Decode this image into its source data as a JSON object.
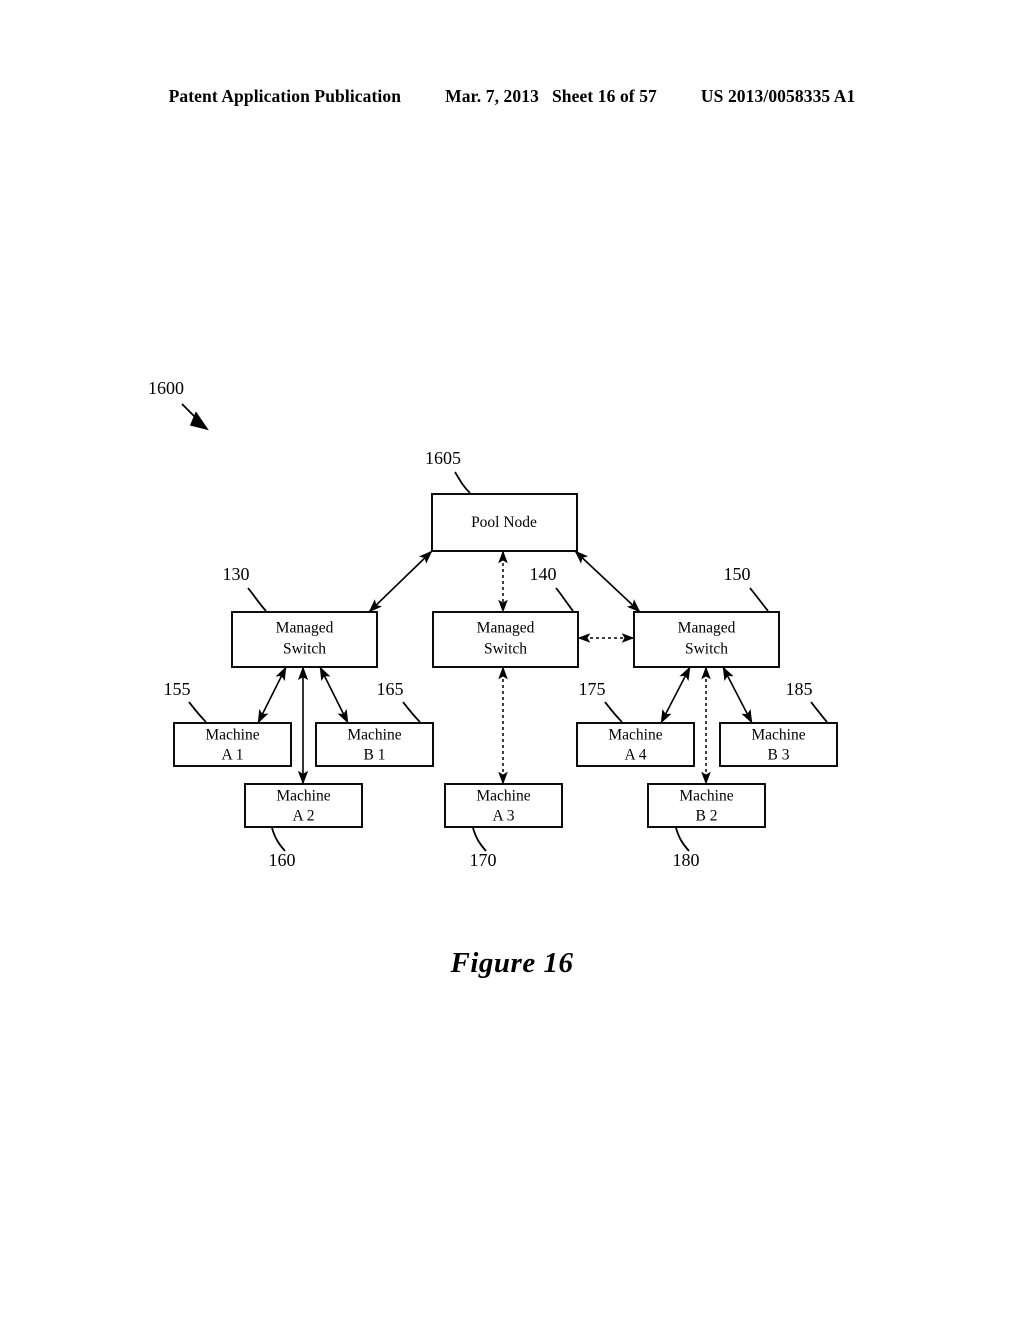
{
  "header": {
    "publication": "Patent Application Publication",
    "date": "Mar. 7, 2013",
    "sheet": "Sheet 16 of 57",
    "doc_number": "US 2013/0058335 A1"
  },
  "figure": {
    "caption": "Figure 16",
    "diagram_ref": "1600"
  },
  "diagram": {
    "pool_node": {
      "ref": "1605",
      "label": "Pool Node"
    },
    "switches": [
      {
        "ref": "130",
        "line1": "Managed",
        "line2": "Switch"
      },
      {
        "ref": "140",
        "line1": "Managed",
        "line2": "Switch"
      },
      {
        "ref": "150",
        "line1": "Managed",
        "line2": "Switch"
      }
    ],
    "machines": [
      {
        "ref": "155",
        "line1": "Machine",
        "line2": "A 1"
      },
      {
        "ref": "165",
        "line1": "Machine",
        "line2": "B 1"
      },
      {
        "ref": "160",
        "line1": "Machine",
        "line2": "A 2"
      },
      {
        "ref": "170",
        "line1": "Machine",
        "line2": "A 3"
      },
      {
        "ref": "175",
        "line1": "Machine",
        "line2": "A 4"
      },
      {
        "ref": "185",
        "line1": "Machine",
        "line2": "B 3"
      },
      {
        "ref": "180",
        "line1": "Machine",
        "line2": "B 2"
      }
    ]
  },
  "colors": {
    "ink": "#000000",
    "paper": "#ffffff"
  }
}
